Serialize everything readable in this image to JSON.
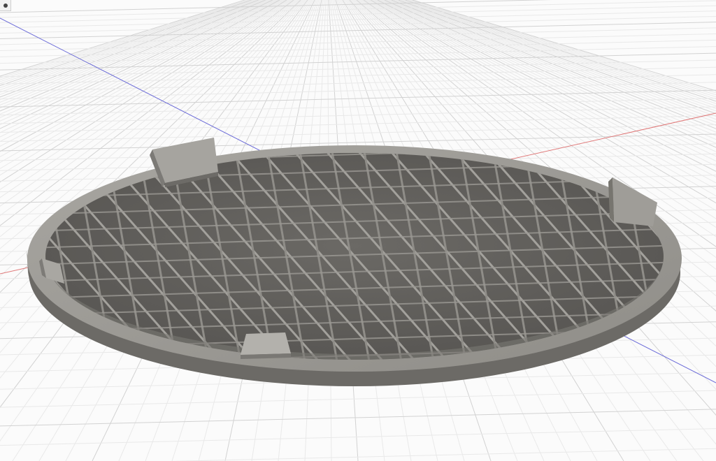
{
  "viewport": {
    "background": "#fbfbfb",
    "grid_minor_color": "#e9e9e9",
    "grid_major_color": "#d2d2d2"
  },
  "axes": {
    "x_axis_color": "#e07a7a",
    "y_axis_color": "#6a6ad8"
  },
  "model": {
    "type": "circular-grid-plate",
    "body_color": "#8b8984",
    "rim_top_color": "#9a9893",
    "rim_side_color": "#6f6d69",
    "rib_color": "#a3a19c",
    "floor_color": "#5d5b58",
    "tab_count": 4
  },
  "toolbar": {
    "corner_icon": "view-cube-dot-icon"
  }
}
